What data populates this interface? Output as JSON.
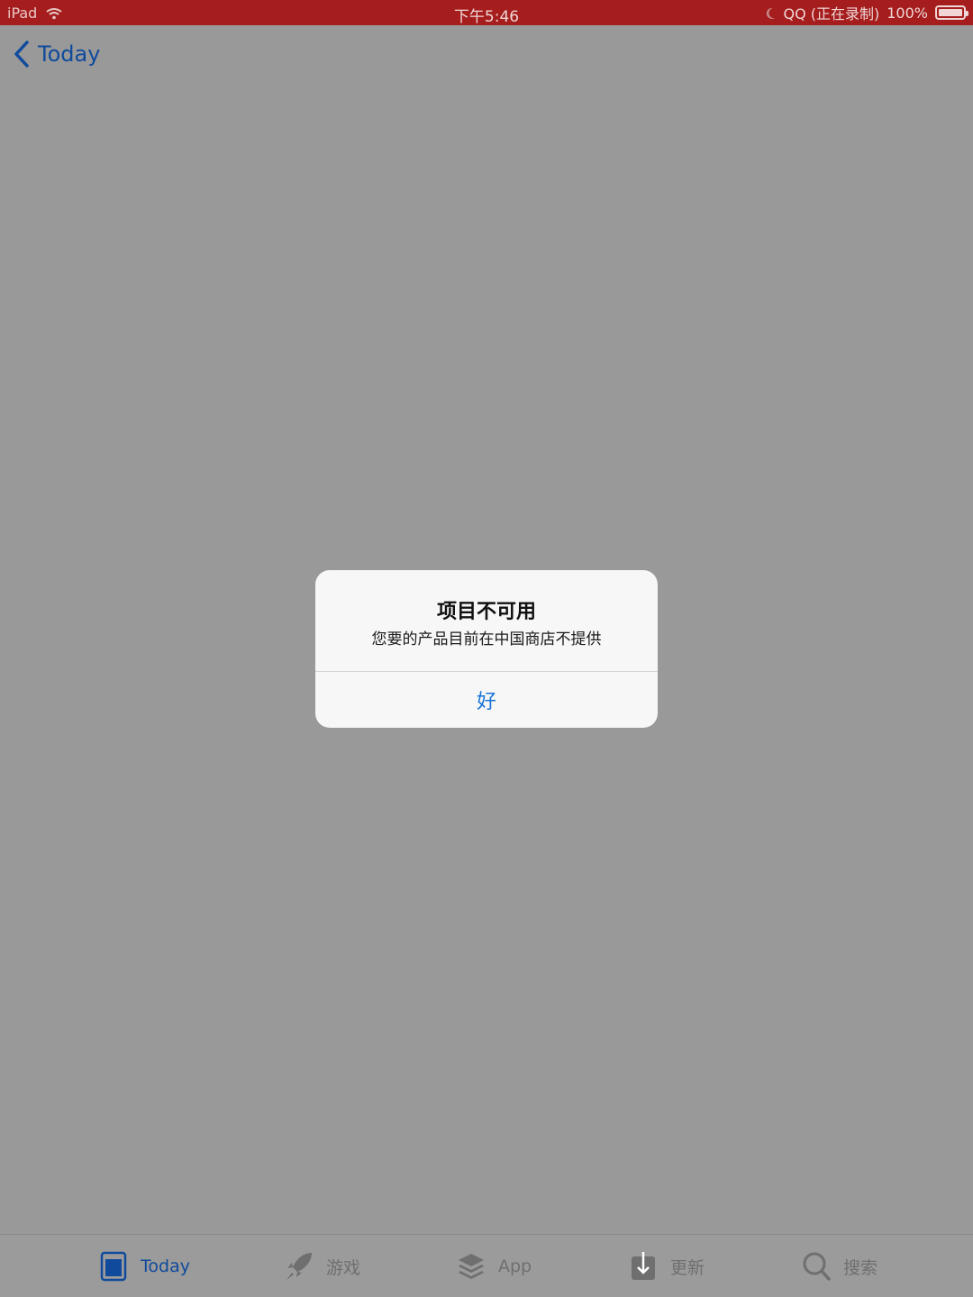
{
  "status_bar": {
    "device": "iPad",
    "time": "下午5:46",
    "recording": "QQ (正在录制)",
    "battery": "100%",
    "icons": [
      "wifi-icon",
      "moon-icon",
      "battery-icon"
    ]
  },
  "nav": {
    "back_label": "Today",
    "back_icon": "chevron-left-icon"
  },
  "alert": {
    "title": "项目不可用",
    "message": "您要的产品目前在中国商店不提供",
    "ok_label": "好"
  },
  "tab_bar": {
    "active_color": "#0f4a9c",
    "inactive_color": "#6f6f6f",
    "items": [
      {
        "label": "Today",
        "icon": "today-icon",
        "active": true
      },
      {
        "label": "游戏",
        "icon": "rocket-icon",
        "active": false
      },
      {
        "label": "App",
        "icon": "app-stack-icon",
        "active": false
      },
      {
        "label": "更新",
        "icon": "download-icon",
        "active": false
      },
      {
        "label": "搜索",
        "icon": "search-icon",
        "active": false
      }
    ]
  },
  "colors": {
    "status_bar_bg": "#a51d1d",
    "background_dim": "#999999",
    "alert_bg": "#f7f7f7",
    "alert_button": "#1a73d8"
  }
}
